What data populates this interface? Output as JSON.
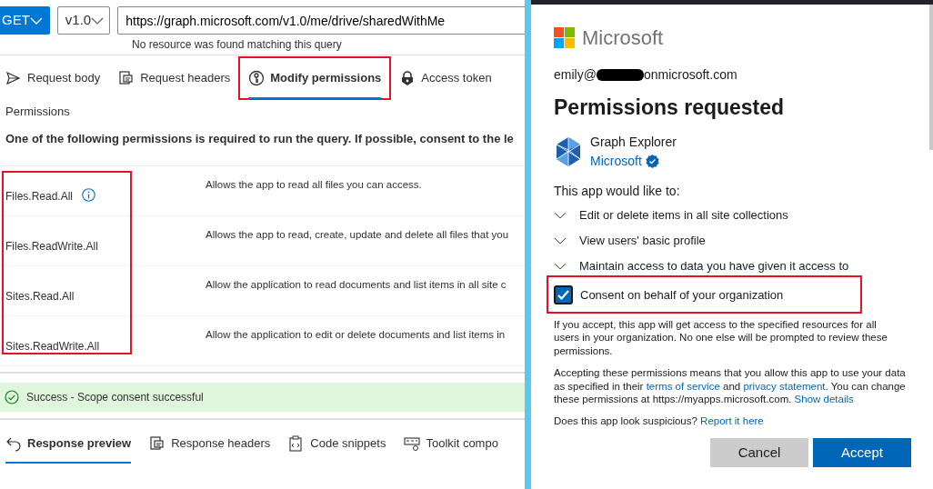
{
  "request": {
    "method": "GET",
    "version": "v1.0",
    "url": "https://graph.microsoft.com/v1.0/me/drive/sharedWithMe",
    "hint": "No resource was found matching this query"
  },
  "request_tabs": [
    {
      "label": "Request body",
      "selected": false,
      "highlighted": false
    },
    {
      "label": "Request headers",
      "selected": false,
      "highlighted": false
    },
    {
      "label": "Modify permissions",
      "selected": true,
      "highlighted": true
    },
    {
      "label": "Access token",
      "selected": false,
      "highlighted": false
    }
  ],
  "permissions": {
    "title": "Permissions",
    "note": "One of the following permissions is required to run the query. If possible, consent to the le",
    "highlighted": true,
    "rows": [
      {
        "name": "Files.Read.All",
        "info": true,
        "description": "Allows the app to read all files you can access."
      },
      {
        "name": "Files.ReadWrite.All",
        "info": false,
        "description": "Allows the app to read, create, update and delete all files that you"
      },
      {
        "name": "Sites.Read.All",
        "info": false,
        "description": "Allow the application to read documents and list items in all site c"
      },
      {
        "name": "Sites.ReadWrite.All",
        "info": false,
        "description": "Allow the application to edit or delete documents and list items in"
      }
    ]
  },
  "status": {
    "kind": "success",
    "message": "Success - Scope consent successful"
  },
  "response_tabs": [
    {
      "label": "Response preview",
      "selected": true
    },
    {
      "label": "Response headers",
      "selected": false
    },
    {
      "label": "Code snippets",
      "selected": false
    },
    {
      "label": "Toolkit compo",
      "selected": false
    }
  ],
  "consent_dialog": {
    "brand": "Microsoft",
    "email_prefix": "emily@",
    "email_suffix": "onmicrosoft.com",
    "title": "Permissions requested",
    "app_name": "Graph Explorer",
    "publisher": "Microsoft",
    "publisher_verified": true,
    "intro": "This app would like to:",
    "scopes": [
      {
        "label": "Edit or delete items in all site collections"
      },
      {
        "label": "View users' basic profile"
      },
      {
        "label": "Maintain access to data you have given it access to"
      }
    ],
    "org_consent": {
      "label": "Consent on behalf of your organization",
      "checked": true,
      "highlighted": true
    },
    "notice": "If you accept, this app will get access to the specified resources for all users in your organization. No one else will be prompted to review these permissions.",
    "terms": [
      {
        "text": "Accepting these permissions means that you allow this app to use your data as specified in their ",
        "link": false
      },
      {
        "text": "terms of service",
        "link": true
      },
      {
        "text": " and ",
        "link": false
      },
      {
        "text": "privacy statement",
        "link": true
      },
      {
        "text": ". You can change these permissions at https://myapps.microsoft.com. ",
        "link": false
      },
      {
        "text": "Show details",
        "link": true
      }
    ],
    "report": [
      {
        "text": "Does this app look suspicious? ",
        "link": false
      },
      {
        "text": "Report it here",
        "link": true
      }
    ],
    "buttons": [
      {
        "label": "Cancel",
        "kind": "secondary"
      },
      {
        "label": "Accept",
        "kind": "primary"
      }
    ]
  }
}
